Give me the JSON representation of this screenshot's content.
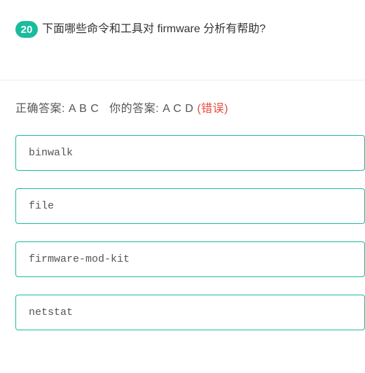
{
  "question": {
    "number": "20",
    "text": "下面哪些命令和工具对 firmware 分析有帮助?"
  },
  "answers": {
    "correct_label": "正确答案: ",
    "correct_value": "A B C",
    "your_label": "你的答案: ",
    "your_value": "A C D",
    "status": "(错误)"
  },
  "options": [
    "binwalk",
    "file",
    "firmware-mod-kit",
    "netstat"
  ]
}
